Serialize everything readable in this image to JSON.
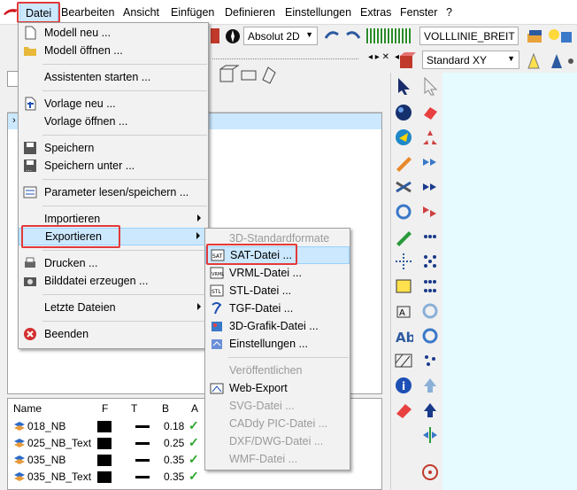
{
  "menubar": {
    "items": [
      "Datei",
      "Bearbeiten",
      "Ansicht",
      "Einfügen",
      "Definieren",
      "Einstellungen",
      "Extras",
      "Fenster",
      "?"
    ]
  },
  "toolbar": {
    "view_mode": "Absolut 2D",
    "line_type": "VOLLLINIE_BREIT",
    "view_select": "Standard XY"
  },
  "file_menu": {
    "items": [
      {
        "label": "Modell neu ...",
        "icon": "new-document-icon"
      },
      {
        "label": "Modell öffnen ...",
        "icon": "open-folder-icon"
      },
      {
        "label": "Assistenten starten ..."
      },
      {
        "label": "Vorlage neu ...",
        "icon": "template-new-icon"
      },
      {
        "label": "Vorlage öffnen ..."
      },
      {
        "label": "Speichern",
        "icon": "save-icon"
      },
      {
        "label": "Speichern unter ...",
        "icon": "save-as-icon"
      },
      {
        "label": "Parameter lesen/speichern ...",
        "icon": "parameter-icon"
      },
      {
        "label": "Importieren"
      },
      {
        "label": "Exportieren"
      },
      {
        "label": "Drucken ...",
        "icon": "print-icon"
      },
      {
        "label": "Bilddatei erzeugen ...",
        "icon": "camera-icon"
      },
      {
        "label": "Letzte Dateien"
      },
      {
        "label": "Beenden",
        "icon": "close-icon"
      }
    ]
  },
  "export_menu": {
    "items": [
      {
        "label": "3D-Standardformate",
        "disabled": true
      },
      {
        "label": "SAT-Datei ...",
        "icon": "sat-icon"
      },
      {
        "label": "VRML-Datei ...",
        "icon": "vrml-icon"
      },
      {
        "label": "STL-Datei ...",
        "icon": "stl-icon"
      },
      {
        "label": "TGF-Datei ...",
        "icon": "tgf-icon"
      },
      {
        "label": "3D-Grafik-Datei ...",
        "icon": "3d-graphic-icon"
      },
      {
        "label": "Einstellungen ...",
        "icon": "settings-icon"
      },
      {
        "label": "Veröffentlichen",
        "disabled": true
      },
      {
        "label": "Web-Export",
        "icon": "web-export-icon"
      },
      {
        "label": "SVG-Datei ...",
        "disabled": true
      },
      {
        "label": "CADdy PIC-Datei ...",
        "disabled": true
      },
      {
        "label": "DXF/DWG-Datei ...",
        "disabled": true
      },
      {
        "label": "WMF-Datei ...",
        "disabled": true
      }
    ]
  },
  "layers": {
    "headers": {
      "name": "Name",
      "f": "F",
      "t": "T",
      "b": "B",
      "a": "A"
    },
    "rows": [
      {
        "name": "018_NB",
        "b": "0.18"
      },
      {
        "name": "025_NB_Text",
        "b": "0.25"
      },
      {
        "name": "035_NB",
        "b": "0.35"
      },
      {
        "name": "035_NB_Text",
        "b": "0.35"
      }
    ]
  },
  "colors": {
    "highlight": "#cce8ff",
    "annotation_red": "#e23a3a",
    "canvas": "#e6fbff"
  }
}
